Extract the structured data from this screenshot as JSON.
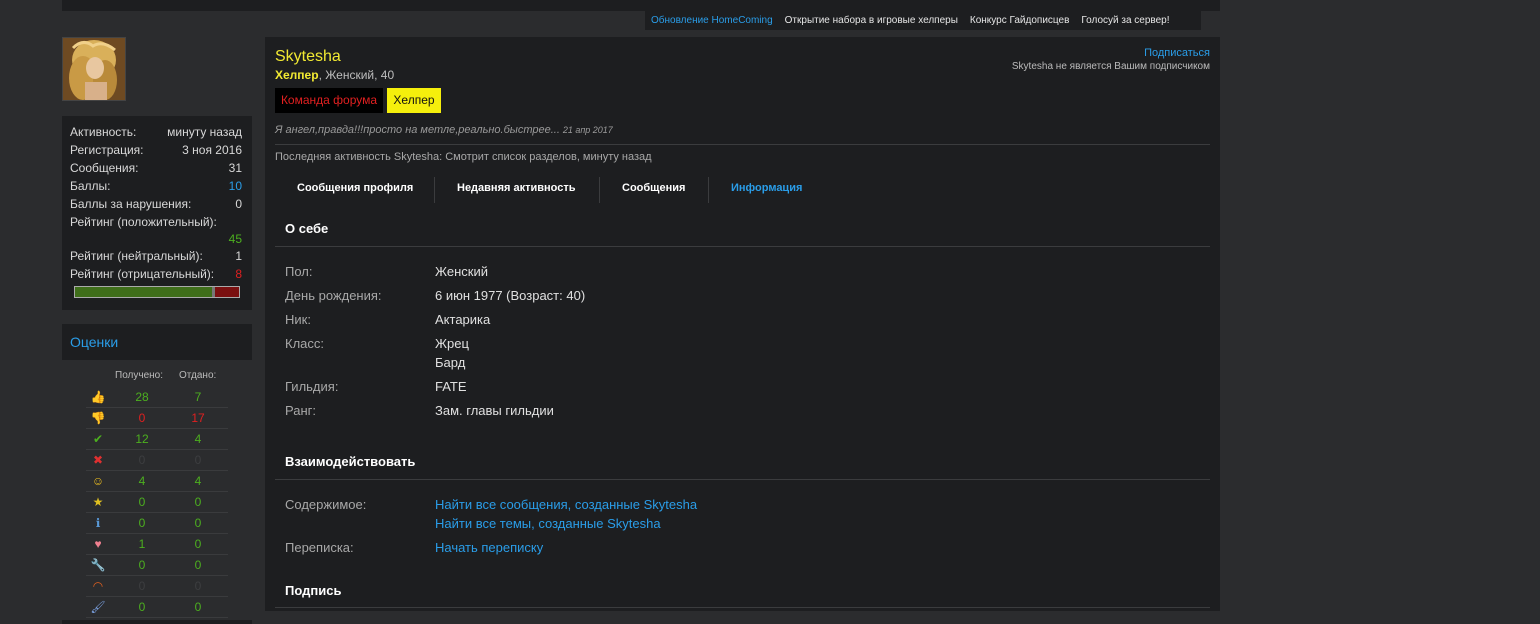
{
  "nav": {
    "links": [
      "Обновление HomeComing",
      "Открытие набора в игровые хелперы",
      "Конкурс Гайдописцев",
      "Голосуй за сервер!"
    ]
  },
  "sidebar": {
    "stats": [
      {
        "label": "Активность:",
        "value": "минуту назад"
      },
      {
        "label": "Регистрация:",
        "value": "3 ноя 2016"
      },
      {
        "label": "Сообщения:",
        "value": "31"
      },
      {
        "label": "Баллы:",
        "value": "10"
      },
      {
        "label": "Баллы за нарушения:",
        "value": "0"
      },
      {
        "label": "Рейтинг (положительный):",
        "value": "45"
      },
      {
        "label": "Рейтинг (нейтральный):",
        "value": "1"
      },
      {
        "label": "Рейтинг (отрицательный):",
        "value": "8"
      }
    ],
    "rating_bar": {
      "positive": 45,
      "neutral": 1,
      "negative": 8
    },
    "grades": {
      "title": "Оценки",
      "received_label": "Получено:",
      "given_label": "Отдано:",
      "rows": [
        {
          "icon": "thumbs-up-icon",
          "received": "28",
          "given": "7"
        },
        {
          "icon": "thumbs-down-icon",
          "received": "0",
          "given": "17"
        },
        {
          "icon": "check-icon",
          "received": "12",
          "given": "4"
        },
        {
          "icon": "cross-icon",
          "received": "0",
          "given": "0"
        },
        {
          "icon": "smile-icon",
          "received": "4",
          "given": "4"
        },
        {
          "icon": "medal-icon",
          "received": "0",
          "given": "0"
        },
        {
          "icon": "info-icon",
          "received": "0",
          "given": "0"
        },
        {
          "icon": "heart-icon",
          "received": "1",
          "given": "0"
        },
        {
          "icon": "wrench-icon",
          "received": "0",
          "given": "0"
        },
        {
          "icon": "rainbow-icon",
          "received": "0",
          "given": "0"
        },
        {
          "icon": "brush-icon",
          "received": "0",
          "given": "0"
        }
      ]
    }
  },
  "profile": {
    "username": "Skytesha",
    "title_strong": "Хелпер",
    "title_rest": ", Женский, 40",
    "banner_team": "Команда форума",
    "banner_helper": "Хелпер",
    "follow_link": "Подписаться",
    "follow_note": "Skytesha не является Вашим подписчиком",
    "status_text": "Я ангел,правда!!!просто на метле,реально.быстрее...",
    "status_date": "21 апр 2017",
    "last_activity": "Последняя активность Skytesha: Смотрит список разделов, минуту назад",
    "tabs": [
      "Сообщения профиля",
      "Недавняя активность",
      "Сообщения",
      "Информация"
    ]
  },
  "about": {
    "heading": "О себе",
    "rows": [
      {
        "label": "Пол:",
        "value": "Женский"
      },
      {
        "label": "День рождения:",
        "value": "6 июн 1977 (Возраст: 40)"
      },
      {
        "label": "Ник:",
        "value": "Актарика"
      },
      {
        "label": "Класс:",
        "value": "Жрец",
        "value2": "Бард"
      },
      {
        "label": "Гильдия:",
        "value": "FATE"
      },
      {
        "label": "Ранг:",
        "value": "Зам. главы гильдии"
      }
    ]
  },
  "interact": {
    "heading": "Взаимодействовать",
    "content_label": "Содержимое:",
    "content_link1": "Найти все сообщения, созданные Skytesha",
    "content_link2": "Найти все темы, созданные Skytesha",
    "convo_label": "Переписка:",
    "convo_link": "Начать переписку"
  },
  "signature": {
    "heading": "Подпись"
  }
}
